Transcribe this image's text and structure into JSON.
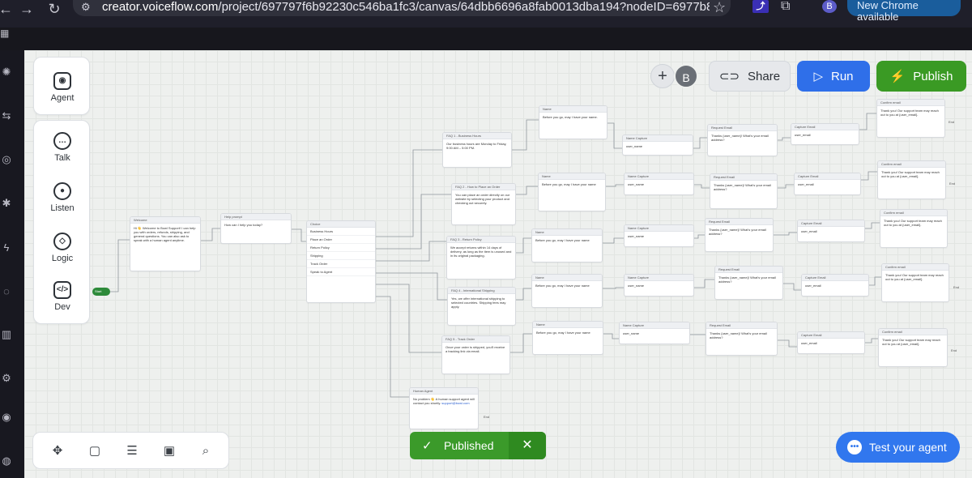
{
  "browser": {
    "url_prefix": "creator.voiceflow.com",
    "url_rest": "/project/697797f6b92230c546ba1fc3/canvas/64dbb6696a8fab0013dba194?nodeID=6977b8aee22e28...",
    "profile_initial": "B",
    "chrome_update_label": "New Chrome available"
  },
  "side_panel": {
    "agent_label": "Agent",
    "talk_label": "Talk",
    "listen_label": "Listen",
    "logic_label": "Logic",
    "dev_label": "Dev"
  },
  "header": {
    "avatar_initial": "B",
    "share_label": "Share",
    "run_label": "Run",
    "publish_label": "Publish"
  },
  "toast": {
    "label": "Published"
  },
  "test_button": {
    "label": "Test your agent"
  },
  "flow": {
    "start_label": "Start",
    "welcome": {
      "title": "Welcome",
      "body": "Hi 👋 Welcome to Bowl Support! I can help you with orders, refunds, shipping, and general questions. You can also ask to speak with a human agent anytime."
    },
    "help_prompt": {
      "title": "Help prompt",
      "body": "How can I help you today?"
    },
    "choice": {
      "title": "Choice",
      "items": [
        "Business Hours",
        "Place an Order",
        "Return Policy",
        "Shipping",
        "Track Order",
        "Speak to Agent"
      ]
    },
    "faqs": [
      {
        "title": "FAQ 1 - Business Hours",
        "body": "Our business hours are Monday to Friday, 9:00 AM – 5:00 PM."
      },
      {
        "title": "FAQ 2 - How to Place an Order",
        "body": "You can place an order directly on our website by selecting your product and checking out securely."
      },
      {
        "title": "FAQ 3 - Return Policy",
        "body": "We accept returns within 14 days of delivery, as long as the item is unused and in its original packaging."
      },
      {
        "title": "FAQ 4 - International Shipping",
        "body": "Yes, we offer international shipping to selected countries. Shipping fees may apply."
      },
      {
        "title": "FAQ 5 - Track Order",
        "body": "Once your order is shipped, you'll receive a tracking link via email."
      }
    ],
    "human_agent": {
      "title": "Human Agent",
      "body": "No problem 👋 A human support agent will contact you shortly.",
      "link": "support@bowl.com",
      "end_label": "End"
    },
    "name_steps": [
      "Before you go, may I have your name.",
      "Before you go, may I have your name",
      "Before you go, may I have your name",
      "Before you go, may I have your name",
      "Before you go, may I have your name"
    ],
    "name_capture_title": "Name Capture",
    "name_capture_var": "user_name",
    "request_email_title": "Request Email",
    "request_email_body": "Thanks {user_name}! What's your email address?",
    "capture_email_title": "Capture Email",
    "capture_email_var": "user_email",
    "confirm_title": "Confirm email",
    "confirm_body": "Thank you! Our support team may reach out to you at {user_email}.",
    "end_label": "End",
    "name_title": "Name"
  }
}
